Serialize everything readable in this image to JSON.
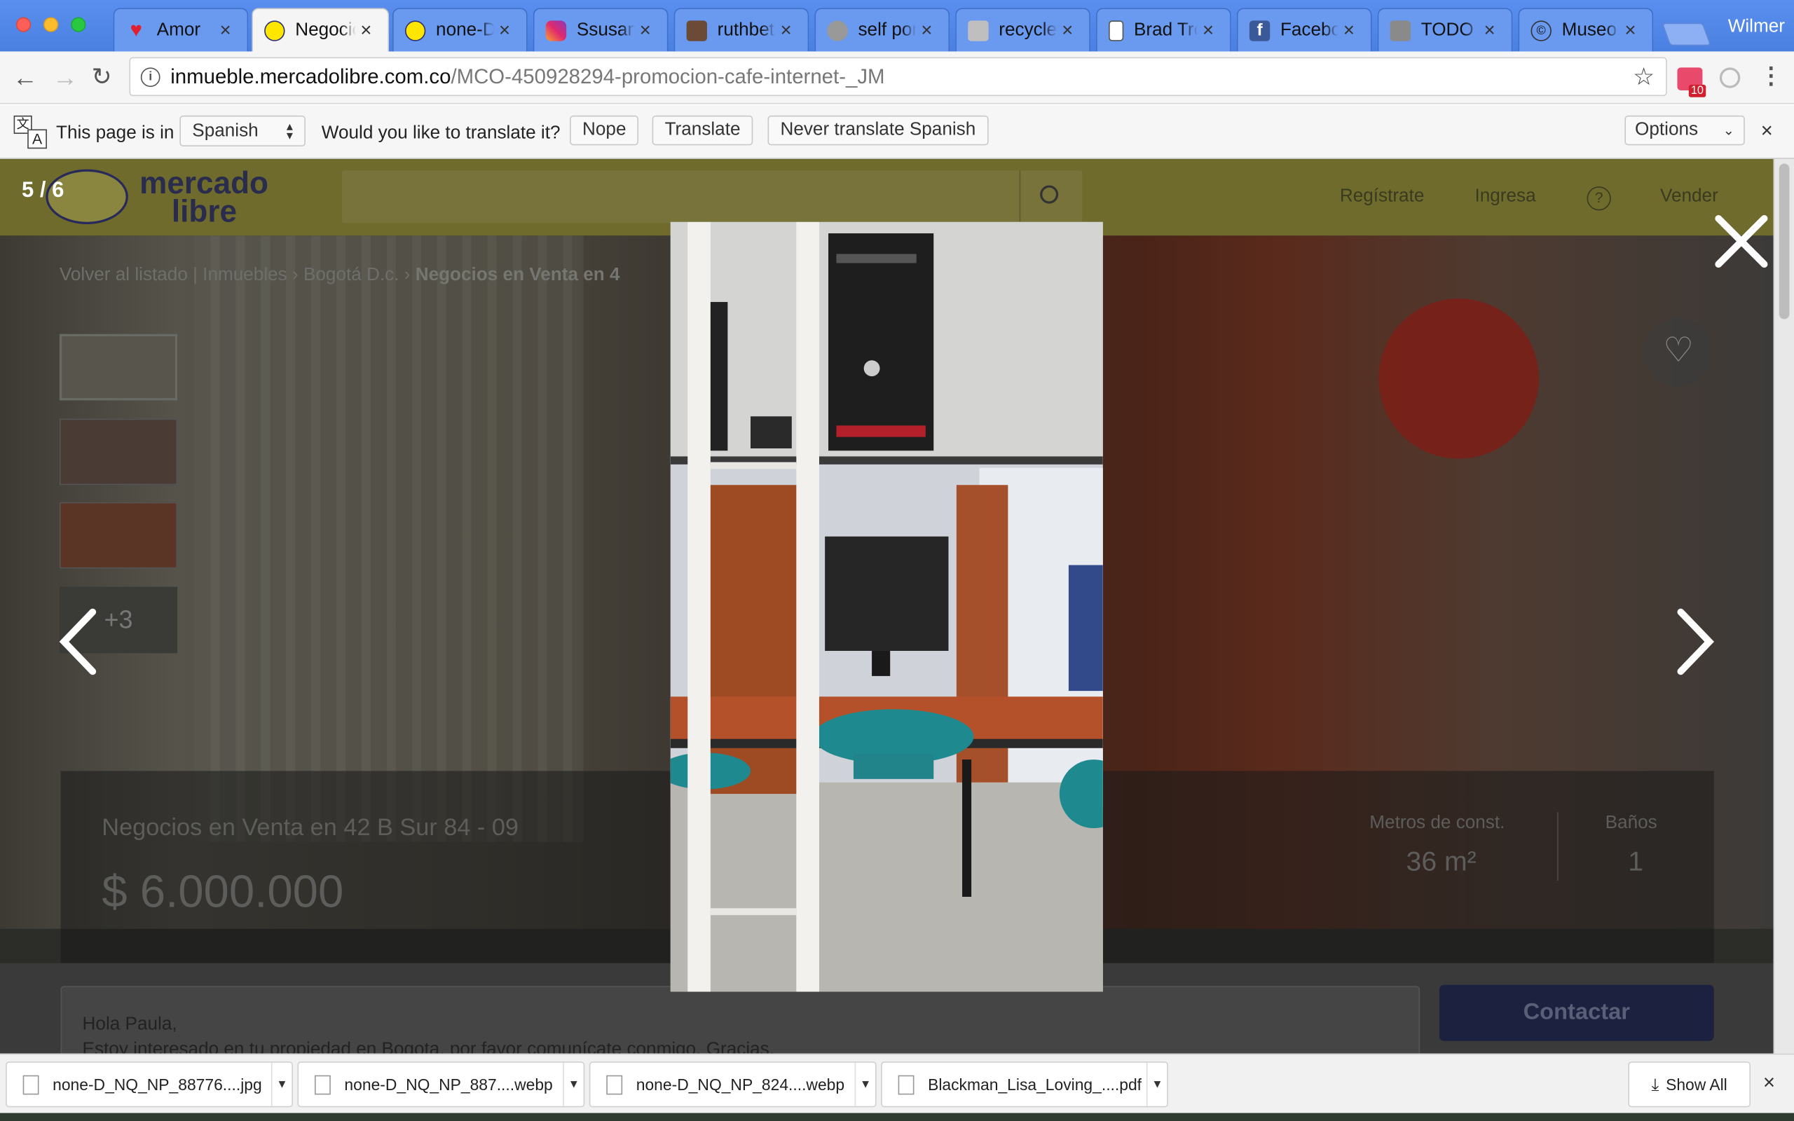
{
  "window": {
    "user_name": "Wilmer"
  },
  "tabs": [
    {
      "label": "Amor",
      "icon": "heart-icon"
    },
    {
      "label": "Negocio",
      "icon": "mercadolibre-icon"
    },
    {
      "label": "none-D_",
      "icon": "mercadolibre-icon"
    },
    {
      "label": "Ssusana",
      "icon": "instagram-icon"
    },
    {
      "label": "ruthbeta",
      "icon": "photo-icon"
    },
    {
      "label": "self port",
      "icon": "photo-icon"
    },
    {
      "label": "recyclec",
      "icon": "photo-icon"
    },
    {
      "label": "Brad Tro",
      "icon": "document-icon"
    },
    {
      "label": "Faceboo",
      "icon": "facebook-icon"
    },
    {
      "label": "TODO V",
      "icon": "photo-icon"
    },
    {
      "label": "Museo F",
      "icon": "copyright-icon"
    }
  ],
  "toolbar": {
    "url_host": "inmueble.mercadolibre.com.co",
    "url_path": "/MCO-450928294-promocion-cafe-internet-_JM",
    "extension_badge": "10"
  },
  "translate_bar": {
    "prefix": "This page is in",
    "language": "Spanish",
    "question": "Would you like to translate it?",
    "nope": "Nope",
    "translate": "Translate",
    "never": "Never translate Spanish",
    "options": "Options"
  },
  "site": {
    "logo_line1": "mercado",
    "logo_line2": "libre",
    "nav": [
      "Regístrate",
      "Ingresa",
      "?",
      "Vender"
    ],
    "breadcrumb": [
      "Volver al listado",
      "|",
      "Inmuebles",
      "›",
      "Bogotá D.c.",
      "›",
      "Negocios en Venta en 4"
    ],
    "thumb_more": "+3",
    "title": "Negocios en Venta en 42 B Sur 84 - 09",
    "price": "$ 6.000.000",
    "specs": [
      {
        "label": "Metros de const.",
        "value": "36 m²"
      },
      {
        "label": "Baños",
        "value": "1"
      }
    ],
    "message": "Hola Paula,\nEstoy interesado en tu propiedad en Bogota, por favor comunícate conmigo. Gracias.",
    "contact_button": "Contactar"
  },
  "lightbox": {
    "counter": "5 / 6"
  },
  "downloads": {
    "items": [
      {
        "name": "none-D_NQ_NP_88776....jpg"
      },
      {
        "name": "none-D_NQ_NP_887....webp"
      },
      {
        "name": "none-D_NQ_NP_824....webp"
      },
      {
        "name": "Blackman_Lisa_Loving_....pdf"
      }
    ],
    "show_all": "Show All"
  }
}
